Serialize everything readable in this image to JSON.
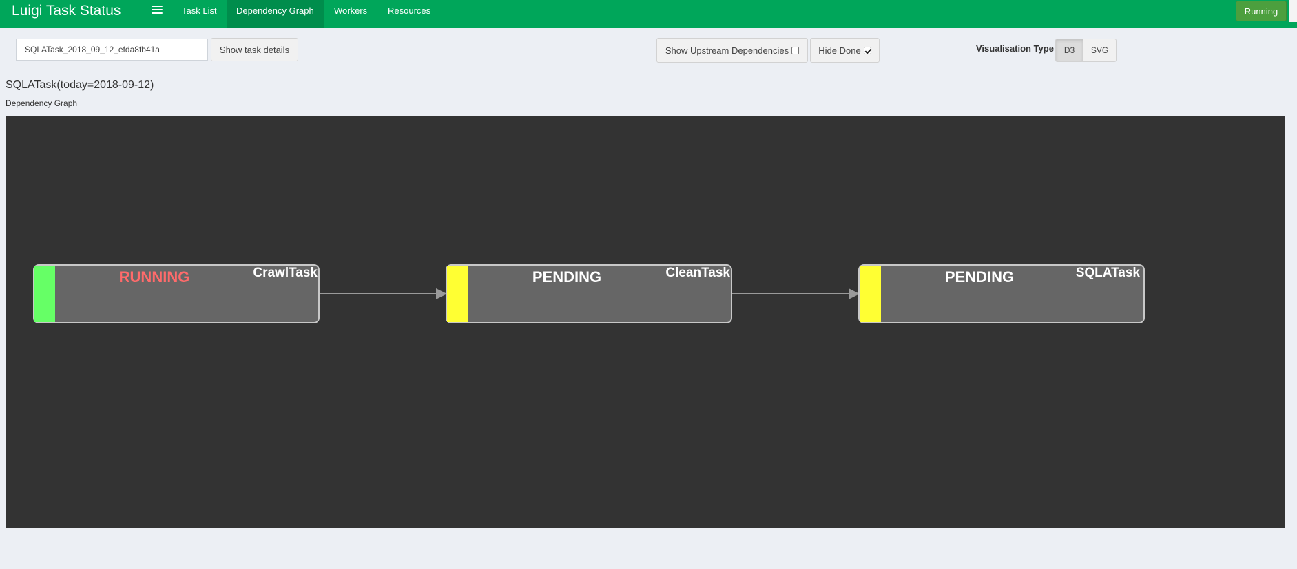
{
  "navbar": {
    "brand": "Luigi Task Status",
    "menu_icon": "hamburger-menu-icon",
    "items": [
      {
        "label": "Task List",
        "active": false
      },
      {
        "label": "Dependency Graph",
        "active": true
      },
      {
        "label": "Workers",
        "active": false
      },
      {
        "label": "Resources",
        "active": false
      }
    ],
    "status_label": "Running",
    "color": "#00a65a"
  },
  "controls": {
    "task_input_value": "SQLATask_2018_09_12_efda8fb41a",
    "show_details_label": "Show task details",
    "upstream_label": "Show Upstream Dependencies",
    "upstream_checked": false,
    "hide_done_label": "Hide Done",
    "hide_done_checked": true,
    "visualisation_label": "Visualisation Type",
    "visualisation_options": [
      "D3",
      "SVG"
    ],
    "visualisation_selected": "D3"
  },
  "task": {
    "title": "SQLATask(today=2018-09-12)",
    "graph_label": "Dependency Graph"
  },
  "graph": {
    "background": "#333333",
    "nodes": [
      {
        "name": "CrawlTask",
        "status": "RUNNING",
        "status_color": "#ff6b6b",
        "bar_color": "#66ff66"
      },
      {
        "name": "CleanTask",
        "status": "PENDING",
        "status_color": "#ffffff",
        "bar_color": "#ffff33"
      },
      {
        "name": "SQLATask",
        "status": "PENDING",
        "status_color": "#ffffff",
        "bar_color": "#ffff33"
      }
    ],
    "edges": [
      {
        "from": "CrawlTask",
        "to": "CleanTask"
      },
      {
        "from": "CleanTask",
        "to": "SQLATask"
      }
    ]
  }
}
